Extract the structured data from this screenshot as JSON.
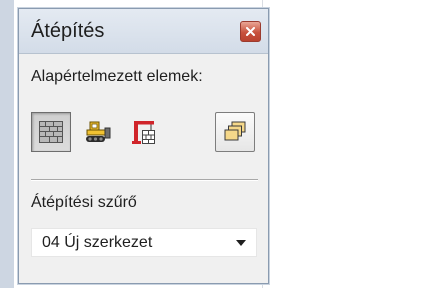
{
  "window": {
    "title": "Átépítés",
    "close_icon": "close-icon"
  },
  "defaults_group": {
    "label": "Alapértelmezett elemek:",
    "buttons": [
      {
        "icon": "brick-wall-icon",
        "state": "pressed"
      },
      {
        "icon": "bulldozer-icon",
        "state": "normal"
      },
      {
        "icon": "crane-icon",
        "state": "normal"
      },
      {
        "icon": "layers-copy-icon",
        "state": "normal"
      }
    ]
  },
  "filter_group": {
    "label": "Átépítési szűrő",
    "selected": "04 Új szerkezet"
  },
  "colors": {
    "panel_bg": "#f0f0f0",
    "title_bg": "#dbe3ee",
    "close_red": "#c8523d",
    "accent_yellow": "#f1c232",
    "accent_red": "#d0242a"
  }
}
